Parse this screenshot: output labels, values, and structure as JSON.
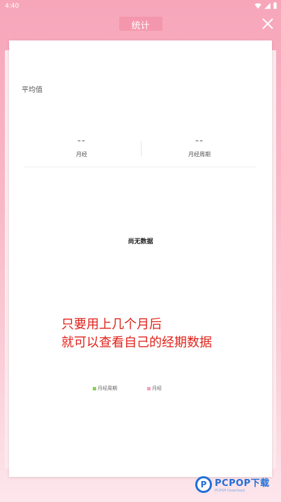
{
  "status_bar": {
    "time": "4:40"
  },
  "header": {
    "title": "统计",
    "close_icon": "close-icon"
  },
  "card": {
    "section_title": "平均值",
    "stats": [
      {
        "value": "--",
        "label": "月经"
      },
      {
        "value": "--",
        "label": "月经周期"
      }
    ],
    "empty_text": "尚无数据",
    "promo_lines": [
      "只要用上几个月后",
      "就可以查看自己的经期数据"
    ],
    "legend": [
      {
        "label": "月经周期",
        "color": "#8ed15e"
      },
      {
        "label": "月经",
        "color": "#f2a3c0"
      }
    ]
  },
  "watermark": {
    "brand": "PCPOP下载",
    "sub": "PCPOP Download",
    "logo_letter": "P"
  },
  "colors": {
    "accent": "#f7a6ba",
    "promo_text": "#e0221b"
  }
}
